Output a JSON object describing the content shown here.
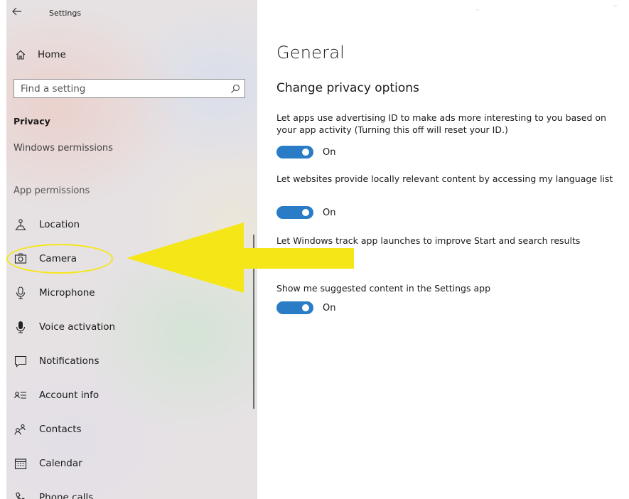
{
  "window": {
    "title": "Settings"
  },
  "sidebar": {
    "home_label": "Home",
    "search_placeholder": "Find a setting",
    "section_privacy": "Privacy",
    "windows_permissions": "Windows permissions",
    "app_permissions": "App permissions",
    "items": [
      {
        "label": "Location",
        "icon": "location-icon"
      },
      {
        "label": "Camera",
        "icon": "camera-icon"
      },
      {
        "label": "Microphone",
        "icon": "microphone-icon"
      },
      {
        "label": "Voice activation",
        "icon": "voice-activation-icon"
      },
      {
        "label": "Notifications",
        "icon": "notifications-icon"
      },
      {
        "label": "Account info",
        "icon": "account-info-icon"
      },
      {
        "label": "Contacts",
        "icon": "contacts-icon"
      },
      {
        "label": "Calendar",
        "icon": "calendar-icon"
      },
      {
        "label": "Phone calls",
        "icon": "phone-calls-icon"
      }
    ]
  },
  "main": {
    "page_title": "General",
    "section_title": "Change privacy options",
    "options": [
      {
        "text": "Let apps use advertising ID to make ads more interesting to you based on your app activity (Turning this off will reset your ID.)",
        "toggle_label": "On",
        "on": true
      },
      {
        "text": "Let websites provide locally relevant content by accessing my language list",
        "toggle_label": "On",
        "on": true
      },
      {
        "text": "Let Windows track app launches to improve Start and search results",
        "toggle_label": "",
        "on": false
      },
      {
        "text": "Show me suggested content in the Settings app",
        "toggle_label": "On",
        "on": true
      }
    ]
  },
  "colors": {
    "toggle_on": "#2a7cc7",
    "annotation": "#f5e617"
  }
}
